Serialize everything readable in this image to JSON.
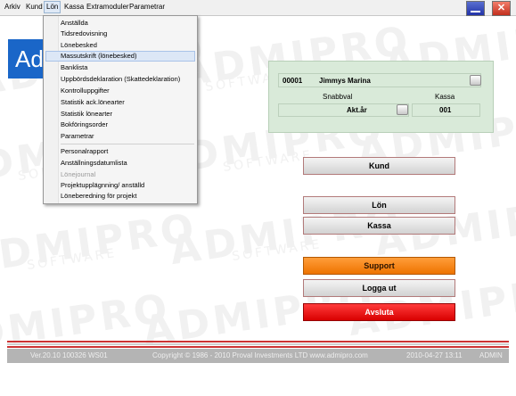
{
  "menubar": {
    "items": [
      "Arkiv",
      "Kund",
      "Lön",
      "Kassa",
      "Extramoduler",
      "Parametrar"
    ]
  },
  "logo": {
    "text": "Ad"
  },
  "lon_menu": {
    "items": [
      {
        "label": "Anställda"
      },
      {
        "label": "Tidsredovisning"
      },
      {
        "label": "Lönebesked"
      },
      {
        "label": "Massutskrift (lönebesked)"
      },
      {
        "label": "Banklista"
      },
      {
        "label": "Uppbördsdeklaration (Skattedeklaration)"
      },
      {
        "label": "Kontrolluppgifter"
      },
      {
        "label": "Statistik ack.lönearter"
      },
      {
        "label": "Statistik lönearter"
      },
      {
        "label": "Bokföringsorder"
      },
      {
        "label": "Parametrar"
      },
      {
        "label": "Personalrapport"
      },
      {
        "label": "Anställningsdatumlista"
      },
      {
        "label": "Lönejournal"
      },
      {
        "label": "Projektupplägnning/ anställd"
      },
      {
        "label": "Löneberedning för projekt"
      }
    ],
    "highlighted": "Massutskrift (lönebesked)"
  },
  "company": {
    "number": "00001",
    "name": "Jimmys Marina",
    "snabbval_label": "Snabbval",
    "kassa_label": "Kassa",
    "snabbval_value": "Akt.år",
    "kassa_value": "001"
  },
  "buttons": {
    "kund": "Kund",
    "lon": "Lön",
    "kassa": "Kassa",
    "support": "Support",
    "logga_ut": "Logga ut",
    "avsluta": "Avsluta"
  },
  "footer": {
    "version": "Ver.20.10 100326 WS01",
    "copyright": "Copyright © 1986 - 2010 Proval Investments LTD www.admipro.com",
    "datetime": "2010-04-27 13:11",
    "user": "ADMIN"
  },
  "watermark": {
    "text": "ADMIPRO",
    "sub": "SOFTWARE"
  },
  "colors": {
    "support": "#ff8a1c",
    "avsluta": "#f00000",
    "panel": "#d9ead9",
    "footer": "#b4b4b4",
    "stripe": "#cc3333"
  }
}
